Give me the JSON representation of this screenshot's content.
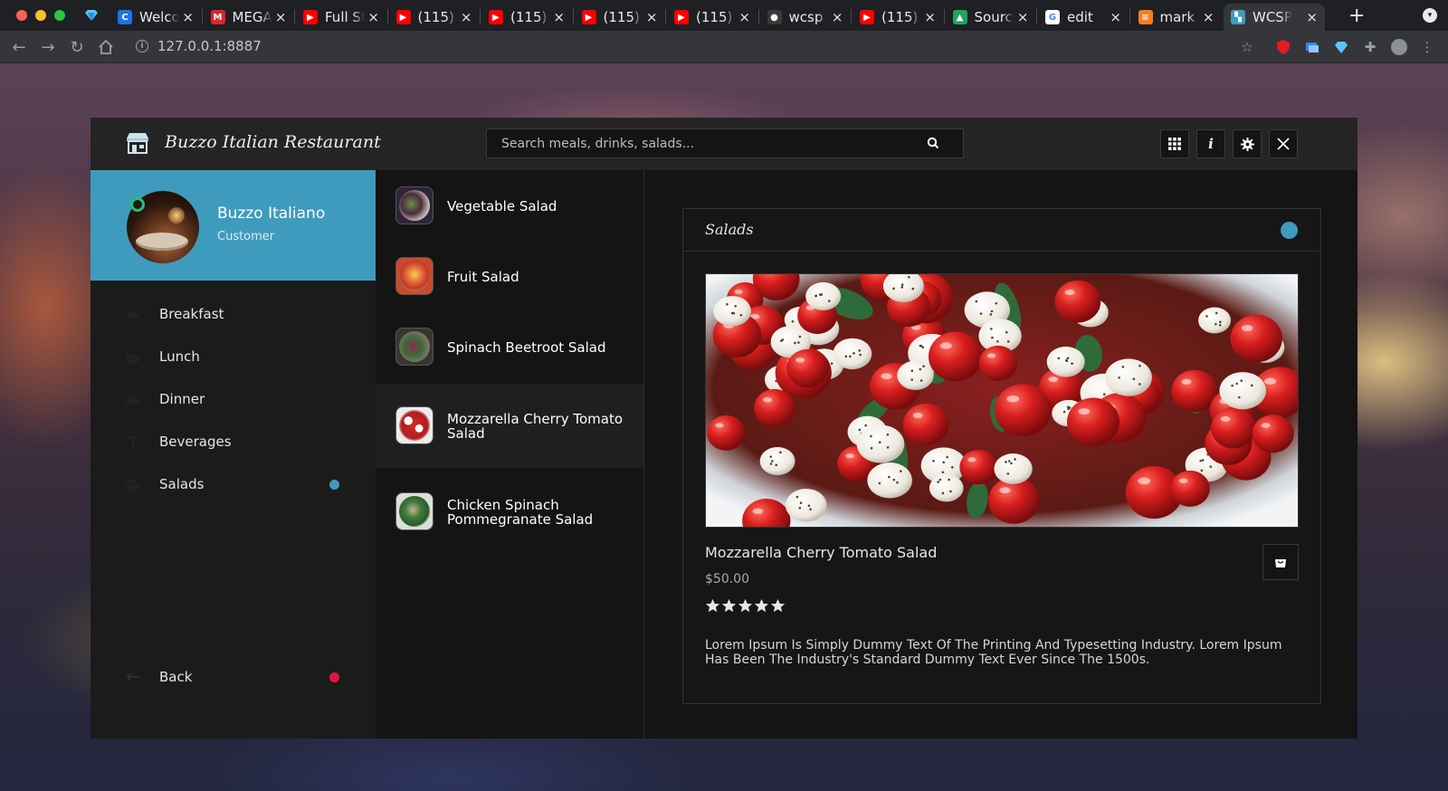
{
  "browser": {
    "tabs": [
      {
        "title": "Welcome",
        "favicon": "c-logo-icon",
        "color": "#1a73e8",
        "letter": "C"
      },
      {
        "title": "MEGA",
        "favicon": "mega-icon",
        "color": "#d9272e",
        "letter": "M"
      },
      {
        "title": "Full Stack",
        "favicon": "youtube-icon",
        "color": "#ff0000",
        "letter": "▶"
      },
      {
        "title": "(115)",
        "favicon": "youtube-icon",
        "color": "#ff0000",
        "letter": "▶"
      },
      {
        "title": "(115)",
        "favicon": "youtube-icon",
        "color": "#ff0000",
        "letter": "▶"
      },
      {
        "title": "(115)",
        "favicon": "youtube-icon",
        "color": "#ff0000",
        "letter": "▶"
      },
      {
        "title": "(115)",
        "favicon": "youtube-icon",
        "color": "#ff0000",
        "letter": "▶"
      },
      {
        "title": "wcsp",
        "favicon": "github-icon",
        "color": "#3a3a3a",
        "letter": "●"
      },
      {
        "title": "(115)",
        "favicon": "youtube-icon",
        "color": "#ff0000",
        "letter": "▶"
      },
      {
        "title": "Source",
        "favicon": "drive-icon",
        "color": "#1fa463",
        "letter": "▲"
      },
      {
        "title": "edit",
        "favicon": "google-icon",
        "color": "#ffffff",
        "letter": "G"
      },
      {
        "title": "mark",
        "favicon": "stackoverflow-icon",
        "color": "#f48024",
        "letter": "≡"
      },
      {
        "title": "WCSP",
        "favicon": "book-icon",
        "color": "#3e9bbd",
        "letter": "▚"
      }
    ],
    "url": "127.0.0.1:8887"
  },
  "app": {
    "brand": "Buzzo Italian Restaurant",
    "search_placeholder": "Search meals, drinks, salads...",
    "accent": "#3e9bbd"
  },
  "profile": {
    "name": "Buzzo Italiano",
    "role": "Customer"
  },
  "menu": [
    {
      "label": "Breakfast",
      "icon": "breakfast-icon"
    },
    {
      "label": "Lunch",
      "icon": "lunch-icon"
    },
    {
      "label": "Dinner",
      "icon": "dinner-icon"
    },
    {
      "label": "Beverages",
      "icon": "beverage-icon"
    },
    {
      "label": "Salads",
      "icon": "salad-icon",
      "active": true
    }
  ],
  "back_label": "Back",
  "items": [
    {
      "name": "Vegetable Salad"
    },
    {
      "name": "Fruit Salad"
    },
    {
      "name": "Spinach Beetroot Salad"
    },
    {
      "name": "Mozzarella Cherry Tomato Salad",
      "selected": true
    },
    {
      "name": "Chicken Spinach Pommegranate Salad"
    }
  ],
  "detail": {
    "category": "Salads",
    "name": "Mozzarella Cherry Tomato Salad",
    "price": "$50.00",
    "rating": 5,
    "description": "Lorem Ipsum Is Simply Dummy Text Of The Printing And Typesetting Industry. Lorem Ipsum Has Been The Industry's Standard Dummy Text Ever Since The 1500s."
  }
}
